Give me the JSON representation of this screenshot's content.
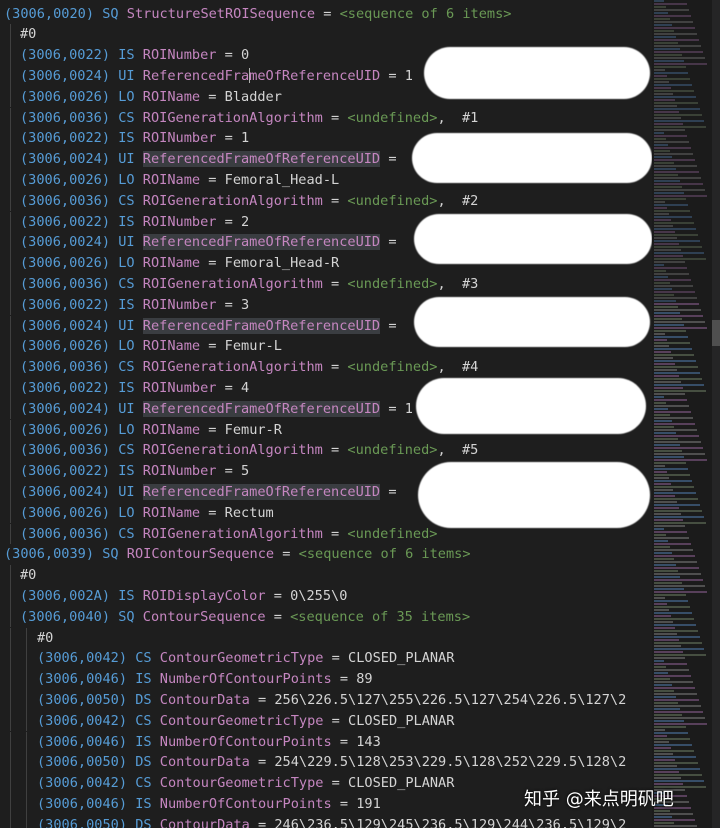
{
  "lines": [
    {
      "ind": 0,
      "tag": "(3006,0020)",
      "vr": "SQ",
      "name": "StructureSetROISequence",
      "eq": "=",
      "val": "",
      "seq": "<sequence of 6 items>",
      "tail": ""
    },
    {
      "ind": 1,
      "idx": "#0"
    },
    {
      "ind": 1,
      "tag": "(3006,0022)",
      "vr": "IS",
      "name": "ROINumber",
      "eq": "=",
      "val": "0"
    },
    {
      "ind": 1,
      "tag": "(3006,0024)",
      "vr": "UI",
      "name": "ReferencedFrameOfReferenceUID",
      "eq": "=",
      "val": "1",
      "cursor": true
    },
    {
      "ind": 1,
      "tag": "(3006,0026)",
      "vr": "LO",
      "name": "ROIName",
      "eq": "=",
      "val": "Bladder"
    },
    {
      "ind": 1,
      "tag": "(3006,0036)",
      "vr": "CS",
      "name": "ROIGenerationAlgorithm",
      "eq": "=",
      "seq": "<undefined>",
      "tail": ",  #1"
    },
    {
      "ind": 1,
      "tag": "(3006,0022)",
      "vr": "IS",
      "name": "ROINumber",
      "eq": "=",
      "val": "1"
    },
    {
      "ind": 1,
      "tag": "(3006,0024)",
      "vr": "UI",
      "name": "ReferencedFrameOfReferenceUID",
      "eq": "=",
      "val": "",
      "hl": true
    },
    {
      "ind": 1,
      "tag": "(3006,0026)",
      "vr": "LO",
      "name": "ROIName",
      "eq": "=",
      "val": "Femoral_Head-L"
    },
    {
      "ind": 1,
      "tag": "(3006,0036)",
      "vr": "CS",
      "name": "ROIGenerationAlgorithm",
      "eq": "=",
      "seq": "<undefined>",
      "tail": ",  #2"
    },
    {
      "ind": 1,
      "tag": "(3006,0022)",
      "vr": "IS",
      "name": "ROINumber",
      "eq": "=",
      "val": "2"
    },
    {
      "ind": 1,
      "tag": "(3006,0024)",
      "vr": "UI",
      "name": "ReferencedFrameOfReferenceUID",
      "eq": "=",
      "val": "",
      "hl": true
    },
    {
      "ind": 1,
      "tag": "(3006,0026)",
      "vr": "LO",
      "name": "ROIName",
      "eq": "=",
      "val": "Femoral_Head-R"
    },
    {
      "ind": 1,
      "tag": "(3006,0036)",
      "vr": "CS",
      "name": "ROIGenerationAlgorithm",
      "eq": "=",
      "seq": "<undefined>",
      "tail": ",  #3"
    },
    {
      "ind": 1,
      "tag": "(3006,0022)",
      "vr": "IS",
      "name": "ROINumber",
      "eq": "=",
      "val": "3"
    },
    {
      "ind": 1,
      "tag": "(3006,0024)",
      "vr": "UI",
      "name": "ReferencedFrameOfReferenceUID",
      "eq": "=",
      "val": "",
      "hl": true
    },
    {
      "ind": 1,
      "tag": "(3006,0026)",
      "vr": "LO",
      "name": "ROIName",
      "eq": "=",
      "val": "Femur-L"
    },
    {
      "ind": 1,
      "tag": "(3006,0036)",
      "vr": "CS",
      "name": "ROIGenerationAlgorithm",
      "eq": "=",
      "seq": "<undefined>",
      "tail": ",  #4"
    },
    {
      "ind": 1,
      "tag": "(3006,0022)",
      "vr": "IS",
      "name": "ROINumber",
      "eq": "=",
      "val": "4"
    },
    {
      "ind": 1,
      "tag": "(3006,0024)",
      "vr": "UI",
      "name": "ReferencedFrameOfReferenceUID",
      "eq": "=",
      "val": "1",
      "hl": true
    },
    {
      "ind": 1,
      "tag": "(3006,0026)",
      "vr": "LO",
      "name": "ROIName",
      "eq": "=",
      "val": "Femur-R"
    },
    {
      "ind": 1,
      "tag": "(3006,0036)",
      "vr": "CS",
      "name": "ROIGenerationAlgorithm",
      "eq": "=",
      "seq": "<undefined>",
      "tail": ",  #5"
    },
    {
      "ind": 1,
      "tag": "(3006,0022)",
      "vr": "IS",
      "name": "ROINumber",
      "eq": "=",
      "val": "5"
    },
    {
      "ind": 1,
      "tag": "(3006,0024)",
      "vr": "UI",
      "name": "ReferencedFrameOfReferenceUID",
      "eq": "=",
      "val": "",
      "hl": true
    },
    {
      "ind": 1,
      "tag": "(3006,0026)",
      "vr": "LO",
      "name": "ROIName",
      "eq": "=",
      "val": "Rectum"
    },
    {
      "ind": 1,
      "tag": "(3006,0036)",
      "vr": "CS",
      "name": "ROIGenerationAlgorithm",
      "eq": "=",
      "seq": "<undefined>",
      "tail": ""
    },
    {
      "ind": 0,
      "tag": "(3006,0039)",
      "vr": "SQ",
      "name": "ROIContourSequence",
      "eq": "=",
      "seq": "<sequence of 6 items>"
    },
    {
      "ind": 1,
      "idx": "#0"
    },
    {
      "ind": 1,
      "tag": "(3006,002A)",
      "vr": "IS",
      "name": "ROIDisplayColor",
      "eq": "=",
      "val": "0\\255\\0"
    },
    {
      "ind": 1,
      "tag": "(3006,0040)",
      "vr": "SQ",
      "name": "ContourSequence",
      "eq": "=",
      "seq": "<sequence of 35 items>"
    },
    {
      "ind": 2,
      "idx": "#0"
    },
    {
      "ind": 2,
      "tag": "(3006,0042)",
      "vr": "CS",
      "name": "ContourGeometricType",
      "eq": "=",
      "val": "CLOSED_PLANAR"
    },
    {
      "ind": 2,
      "tag": "(3006,0046)",
      "vr": "IS",
      "name": "NumberOfContourPoints",
      "eq": "=",
      "val": "89"
    },
    {
      "ind": 2,
      "tag": "(3006,0050)",
      "vr": "DS",
      "name": "ContourData",
      "eq": "=",
      "val": "256\\226.5\\127\\255\\226.5\\127\\254\\226.5\\127\\2"
    },
    {
      "ind": 2,
      "tag": "(3006,0042)",
      "vr": "CS",
      "name": "ContourGeometricType",
      "eq": "=",
      "val": "CLOSED_PLANAR"
    },
    {
      "ind": 2,
      "tag": "(3006,0046)",
      "vr": "IS",
      "name": "NumberOfContourPoints",
      "eq": "=",
      "val": "143"
    },
    {
      "ind": 2,
      "tag": "(3006,0050)",
      "vr": "DS",
      "name": "ContourData",
      "eq": "=",
      "val": "254\\229.5\\128\\253\\229.5\\128\\252\\229.5\\128\\2"
    },
    {
      "ind": 2,
      "tag": "(3006,0042)",
      "vr": "CS",
      "name": "ContourGeometricType",
      "eq": "=",
      "val": "CLOSED_PLANAR"
    },
    {
      "ind": 2,
      "tag": "(3006,0046)",
      "vr": "IS",
      "name": "NumberOfContourPoints",
      "eq": "=",
      "val": "191"
    },
    {
      "ind": 2,
      "tag": "(3006,0050)",
      "vr": "DS",
      "name": "ContourData",
      "eq": "=",
      "val": "246\\236.5\\129\\245\\236.5\\129\\244\\236.5\\129\\2"
    }
  ],
  "watermark": "知乎 @来点明矾吧",
  "colors": {
    "background": "#1e1e1e",
    "tag": "#569cd6",
    "keyword": "#c586c0",
    "sequence_comment": "#6a9955",
    "text": "#d4d4d4"
  }
}
